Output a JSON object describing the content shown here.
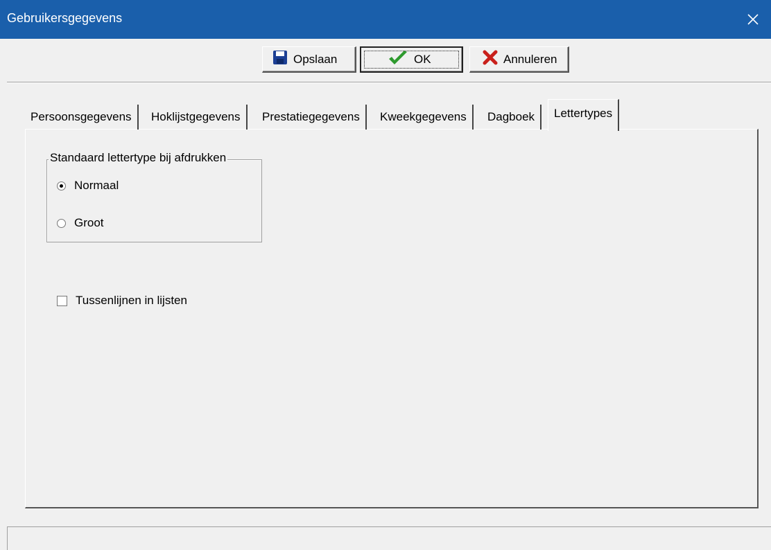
{
  "window": {
    "title": "Gebruikersgegevens",
    "accent_color": "#1a5fab"
  },
  "toolbar": {
    "save_label": "Opslaan",
    "save_icon": "floppy-disk-icon",
    "ok_label": "OK",
    "ok_icon": "green-check-icon",
    "cancel_label": "Annuleren",
    "cancel_icon": "red-x-icon"
  },
  "tabs": [
    {
      "label": "Persoonsgegevens",
      "active": false
    },
    {
      "label": "Hoklijstgegevens",
      "active": false
    },
    {
      "label": "Prestatiegegevens",
      "active": false
    },
    {
      "label": "Kweekgegevens",
      "active": false
    },
    {
      "label": "Dagboek",
      "active": false
    },
    {
      "label": "Lettertypes",
      "active": true
    }
  ],
  "font_group": {
    "legend": "Standaard lettertype bij afdrukken",
    "options": [
      {
        "label": "Normaal",
        "checked": true
      },
      {
        "label": "Groot",
        "checked": false
      }
    ]
  },
  "gridlines": {
    "label": "Tussenlijnen in lijsten",
    "checked": false
  }
}
